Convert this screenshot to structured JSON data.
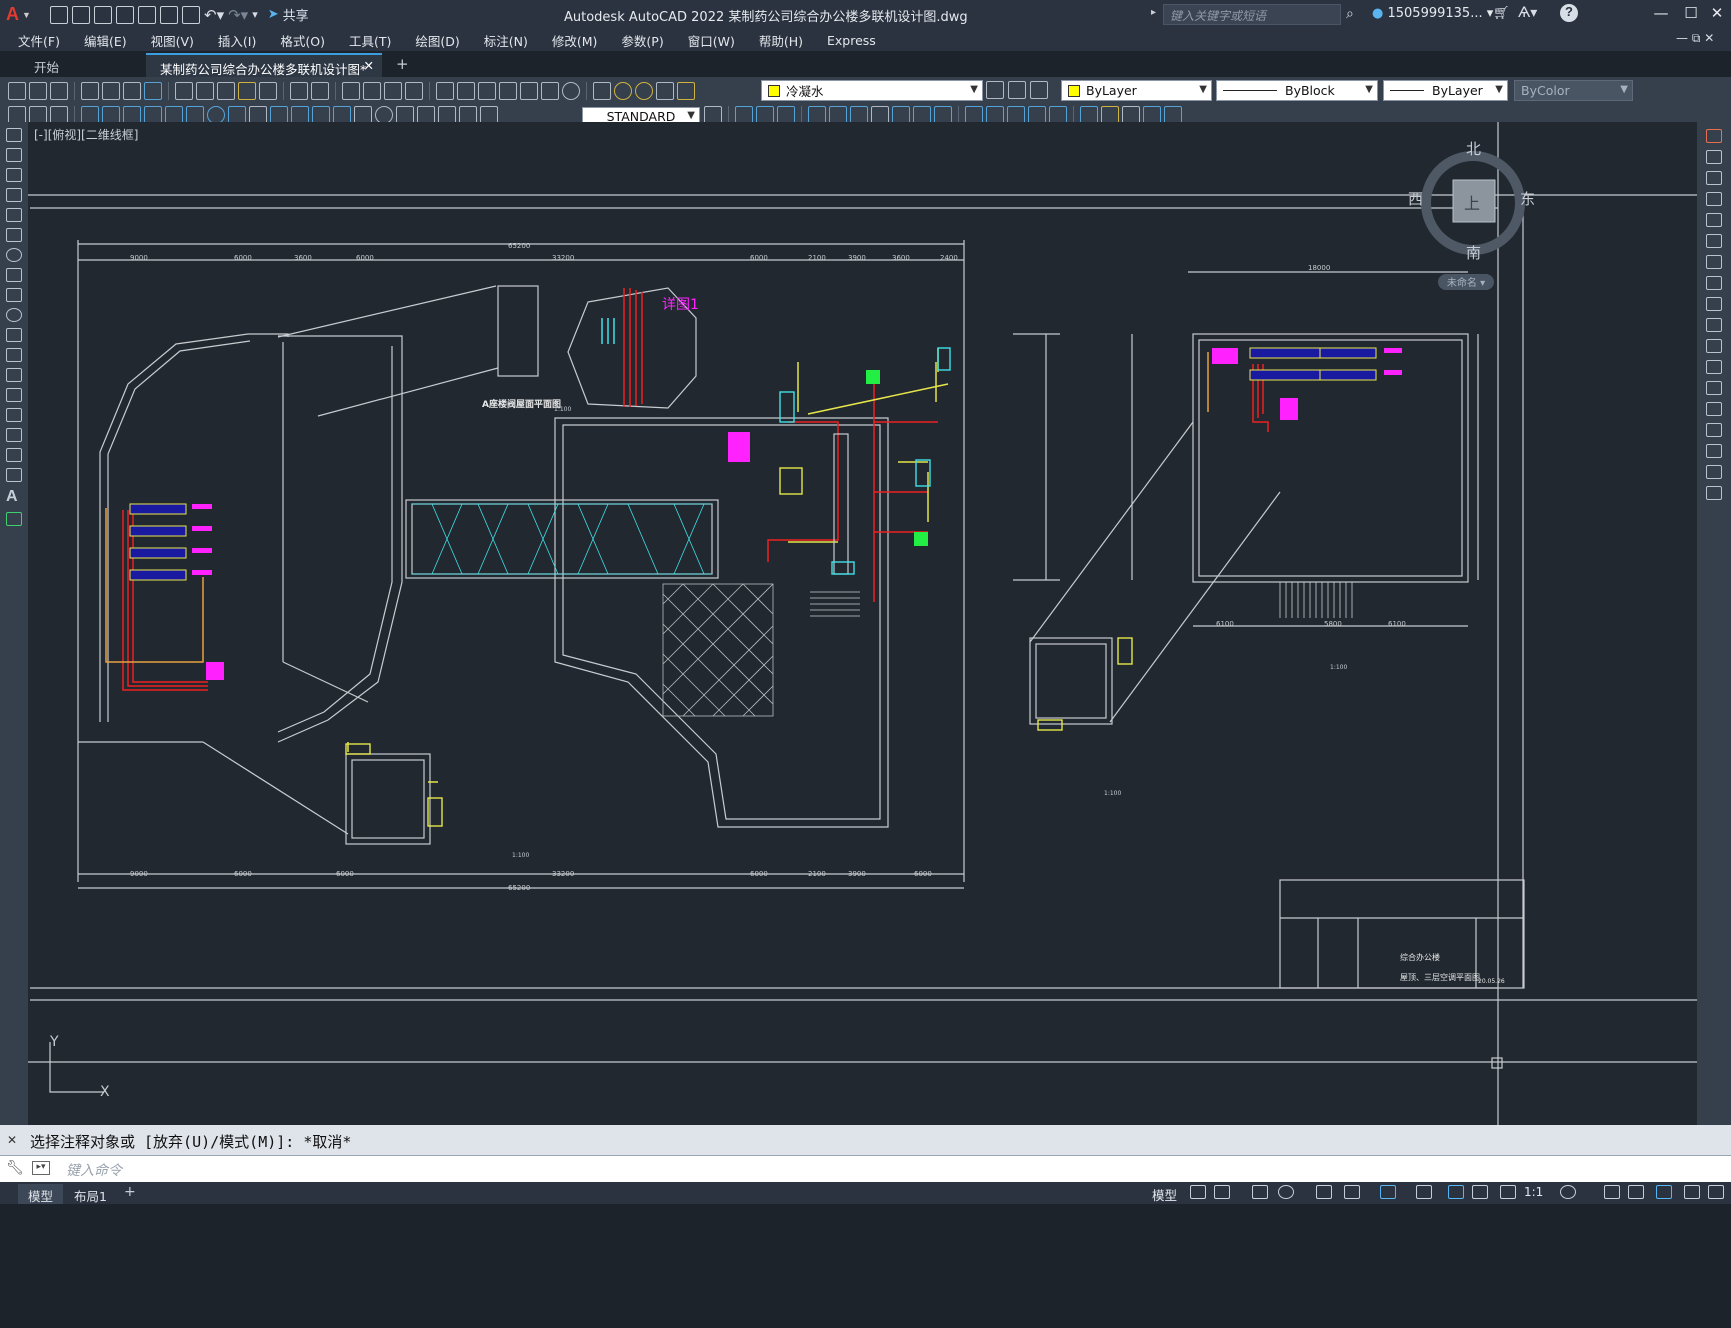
{
  "app": {
    "logo": "A",
    "title": "Autodesk AutoCAD 2022    某制药公司综合办公楼多联机设计图.dwg",
    "share_label": "共享",
    "search_placeholder": "键入关键字或短语",
    "user": "1505999135...",
    "icons": [
      "new-icon",
      "open-icon",
      "save-icon",
      "saveas-icon",
      "plot-icon",
      "undo-icon",
      "redo-icon",
      "cart-icon",
      "help-icon"
    ]
  },
  "menu": [
    "文件(F)",
    "编辑(E)",
    "视图(V)",
    "插入(I)",
    "格式(O)",
    "工具(T)",
    "绘图(D)",
    "标注(N)",
    "修改(M)",
    "参数(P)",
    "窗口(W)",
    "帮助(H)",
    "Express"
  ],
  "tabs": [
    {
      "label": "开始",
      "active": false
    },
    {
      "label": "某制药公司综合办公楼多联机设计图*",
      "active": true
    }
  ],
  "toolbar": {
    "layer_name": "冷凝水",
    "color": "ByLayer",
    "linetype": "ByBlock",
    "lineweight": "ByLayer",
    "plotstyle": "ByColor",
    "textstyle": "STANDARD"
  },
  "drawing": {
    "viewport_label": "[-][俯视][二维线框]",
    "compass": {
      "north": "北",
      "south": "南",
      "east": "东",
      "west": "西",
      "top": "上",
      "wcs": "未命名"
    },
    "dims_top": [
      "65200",
      "9000",
      "6000",
      "3600",
      "6000",
      "33200",
      "6000",
      "2100",
      "3900",
      "3600",
      "2400"
    ],
    "dims_bottom": [
      "65200",
      "9000",
      "6000",
      "6000",
      "33200",
      "6000",
      "2100",
      "3900",
      "6000"
    ],
    "dims_right": [
      "18000",
      "6100",
      "5800",
      "6100"
    ],
    "detail_label": "详图1",
    "plan_title": "A座楼阀屋面平面图",
    "scale": "1:100",
    "ucs_y": "Y",
    "ucs_x": "X",
    "title_block": {
      "project": "综合办公楼",
      "sheet": "屋顶、三层空调平面图",
      "date": "20.05.26"
    }
  },
  "command": {
    "history": "选择注释对象或 [放弃(U)/模式(M)]: *取消*",
    "placeholder": "键入命令"
  },
  "status": {
    "layouts": [
      "模型",
      "布局1"
    ],
    "model_label": "模型",
    "scale": "1:1"
  },
  "colors": {
    "canvas_bg": "#212830",
    "line": "#c8ccd0",
    "cyan": "#3fe0e8",
    "yellow": "#e6e64a",
    "red": "#ee2020",
    "magenta": "#ff22ff",
    "green": "#22ee44",
    "orange": "#e8a040",
    "accent": "#3a9ee0"
  }
}
